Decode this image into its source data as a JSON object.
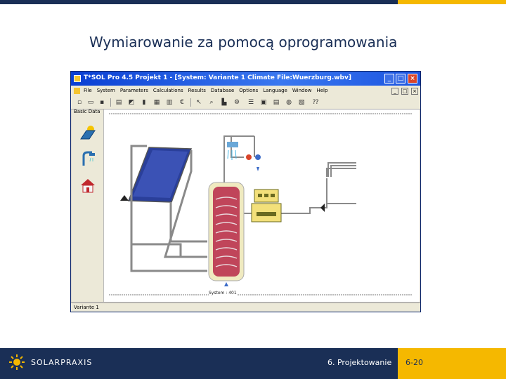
{
  "slide": {
    "title": "Wymiarowanie za pomocą oprogramowania"
  },
  "window": {
    "title": "T*SOL Pro 4.5 Projekt 1 - [System: Variante 1    Climate File:Wuerzburg.wbv]",
    "controls": [
      "_",
      "□",
      "×"
    ],
    "mdi_controls": [
      "_",
      "□",
      "×"
    ]
  },
  "menu": {
    "items": [
      "File",
      "System",
      "Parameters",
      "Calculations",
      "Results",
      "Database",
      "Options",
      "Language",
      "Window",
      "Help"
    ]
  },
  "sidebar": {
    "label": "Basic Data",
    "icons": [
      "solar-collector-icon",
      "shower-icon",
      "house-icon"
    ]
  },
  "diagram": {
    "system_label": "System : 401"
  },
  "statusbar": {
    "text": "Variante 1"
  },
  "footer": {
    "logo_text": "SOLARPRAXIS",
    "section": "6. Projektowanie",
    "page": "6-20"
  },
  "colors": {
    "navy": "#1a2f56",
    "gold": "#f5b800",
    "tank_red": "#c0455a",
    "collector_blue": "#2a3f9a",
    "controller_yellow": "#f3e07a"
  }
}
